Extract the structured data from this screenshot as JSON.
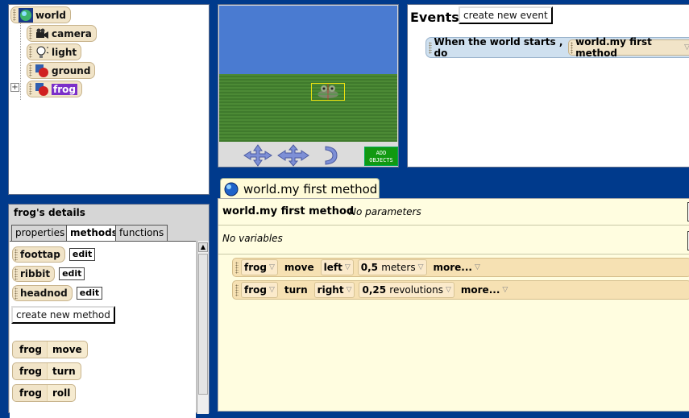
{
  "tree": {
    "items": [
      {
        "label": "world",
        "icon": "globe-icon",
        "selected": false
      },
      {
        "label": "camera",
        "icon": "camera-icon",
        "selected": false
      },
      {
        "label": "light",
        "icon": "lightbulb-icon",
        "selected": false
      },
      {
        "label": "ground",
        "icon": "object-icon",
        "selected": false
      },
      {
        "label": "frog",
        "icon": "object-icon",
        "selected": true
      }
    ],
    "expand_symbol": "+"
  },
  "view": {
    "add_objects_line1": "ADD",
    "add_objects_line2": "OBJECTS"
  },
  "events": {
    "title": "Events",
    "create_button": "create new event",
    "rows": [
      {
        "trigger": "When the world starts ,  do",
        "method": "world.my first method"
      }
    ]
  },
  "details": {
    "title": "frog's details",
    "tabs": [
      "properties",
      "methods",
      "functions"
    ],
    "active_tab": "methods",
    "methods": [
      {
        "name": "foottap",
        "edit": "edit"
      },
      {
        "name": "ribbit",
        "edit": "edit"
      },
      {
        "name": "headnod",
        "edit": "edit"
      }
    ],
    "create_method_button": "create new method",
    "primitives": [
      {
        "object": "frog",
        "action": "move"
      },
      {
        "object": "frog",
        "action": "turn"
      },
      {
        "object": "frog",
        "action": "roll"
      }
    ]
  },
  "editor": {
    "tab_title": "world.my first method",
    "header": "world.my first method",
    "params": "No parameters",
    "vars": "No variables",
    "statements": [
      {
        "object": "frog",
        "verb": "move",
        "direction": "left",
        "amount": "0,5",
        "unit": "meters",
        "more": "more..."
      },
      {
        "object": "frog",
        "verb": "turn",
        "direction": "right",
        "amount": "0,25",
        "unit": "revolutions",
        "more": "more..."
      }
    ]
  },
  "colors": {
    "background": "#003a8c",
    "tile": "#f1e4c8",
    "selection": "#7b2fc9",
    "editor_bg": "#fffde0",
    "sky": "#4a7bd1",
    "grass": "#4c8a35"
  }
}
